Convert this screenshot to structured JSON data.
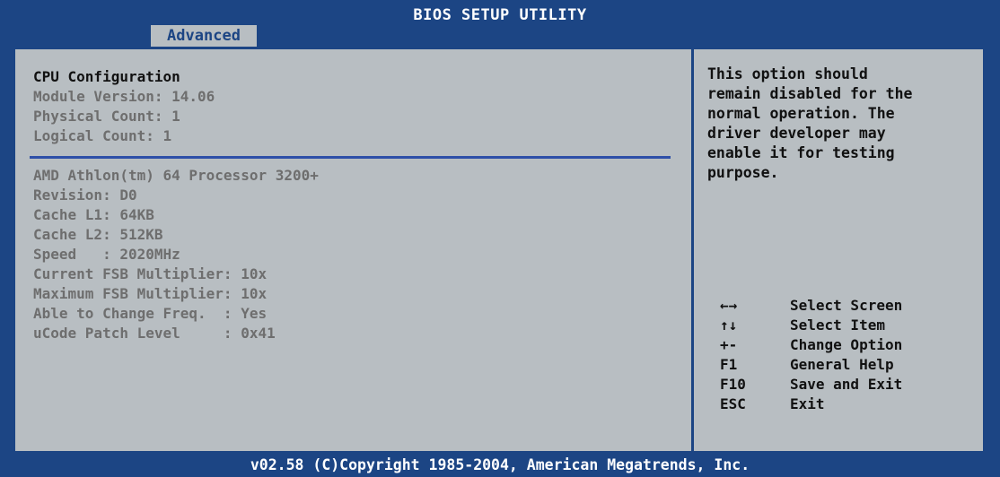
{
  "header": {
    "title": "BIOS SETUP UTILITY",
    "active_tab": "Advanced"
  },
  "left_panel": {
    "section_title": "CPU Configuration",
    "summary": [
      "Module Version: 14.06",
      "Physical Count: 1",
      "Logical Count: 1"
    ],
    "cpu_info": [
      "AMD Athlon(tm) 64 Processor 3200+",
      "Revision: D0",
      "Cache L1: 64KB",
      "Cache L2: 512KB",
      "Speed   : 2020MHz",
      "Current FSB Multiplier: 10x",
      "Maximum FSB Multiplier: 10x",
      "Able to Change Freq.  : Yes",
      "uCode Patch Level     : 0x41"
    ]
  },
  "help_panel": {
    "lines": [
      "This option should",
      "remain disabled for the",
      "normal operation. The",
      "driver developer may",
      "enable it for testing",
      "purpose."
    ],
    "keys": [
      {
        "key": "←→",
        "icon": "left-right-arrow-icon",
        "label": "Select Screen"
      },
      {
        "key": "↑↓",
        "icon": "up-down-arrow-icon",
        "label": "Select Item"
      },
      {
        "key": "+-",
        "label": "Change Option"
      },
      {
        "key": "F1",
        "label": "General Help"
      },
      {
        "key": "F10",
        "label": "Save and Exit"
      },
      {
        "key": "ESC",
        "label": "Exit"
      }
    ]
  },
  "footer": {
    "text": "v02.58 (C)Copyright 1985-2004, American Megatrends, Inc."
  },
  "colors": {
    "frame_blue": "#1c4584",
    "panel_gray": "#b8bec2",
    "dim_text": "#6e6e6e",
    "separator": "#2e4fa8"
  }
}
